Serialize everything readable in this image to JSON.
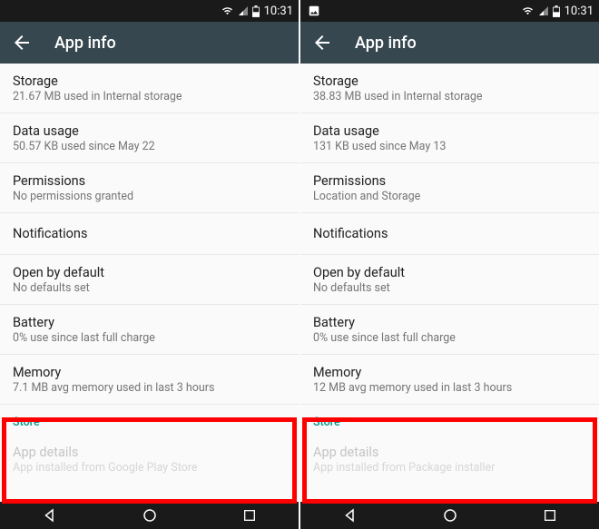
{
  "panels": [
    {
      "status": {
        "time": "10:31",
        "showPictureIcon": false
      },
      "header": {
        "title": "App info"
      },
      "items": [
        {
          "title": "Storage",
          "sub": "21.67 MB used in Internal storage"
        },
        {
          "title": "Data usage",
          "sub": "50.57 KB used since May 22"
        },
        {
          "title": "Permissions",
          "sub": "No permissions granted"
        },
        {
          "title": "Notifications",
          "sub": null
        },
        {
          "title": "Open by default",
          "sub": "No defaults set"
        },
        {
          "title": "Battery",
          "sub": "0% use since last full charge"
        },
        {
          "title": "Memory",
          "sub": "7.1 MB avg memory used in last 3 hours"
        }
      ],
      "store": {
        "header": "Store",
        "title": "App details",
        "sub": "App installed from Google Play Store"
      }
    },
    {
      "status": {
        "time": "10:31",
        "showPictureIcon": true
      },
      "header": {
        "title": "App info"
      },
      "items": [
        {
          "title": "Storage",
          "sub": "38.83 MB used in Internal storage"
        },
        {
          "title": "Data usage",
          "sub": "131 KB used since May 13"
        },
        {
          "title": "Permissions",
          "sub": "Location and Storage"
        },
        {
          "title": "Notifications",
          "sub": null
        },
        {
          "title": "Open by default",
          "sub": "No defaults set"
        },
        {
          "title": "Battery",
          "sub": "0% use since last full charge"
        },
        {
          "title": "Memory",
          "sub": "12 MB avg memory used in last 3 hours"
        }
      ],
      "store": {
        "header": "Store",
        "title": "App details",
        "sub": "App installed from Package installer"
      }
    }
  ]
}
